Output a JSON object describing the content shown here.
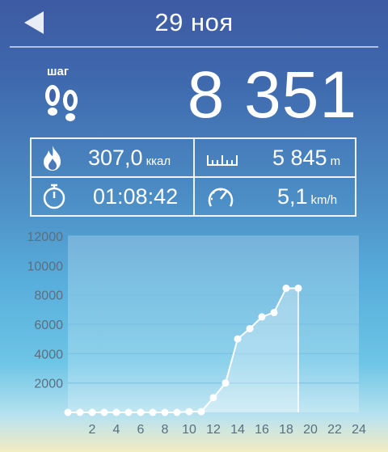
{
  "header": {
    "date": "29 ноя",
    "back_icon": "back-arrow-icon"
  },
  "steps": {
    "label": "шаг",
    "value": "8 351",
    "icon": "footprints-icon"
  },
  "stats": {
    "calories": {
      "value": "307,0",
      "unit": "ккал",
      "icon": "flame-icon"
    },
    "distance": {
      "value": "5 845",
      "unit": "m",
      "icon": "ruler-icon"
    },
    "duration": {
      "value": "01:08:42",
      "icon": "stopwatch-icon"
    },
    "speed": {
      "value": "5,1",
      "unit": "km/h",
      "icon": "speedometer-icon"
    }
  },
  "chart_data": {
    "type": "line",
    "title": "",
    "xlabel": "",
    "ylabel": "",
    "ylim": [
      0,
      12000
    ],
    "xlim": [
      0,
      24
    ],
    "yticks": [
      "2000",
      "4000",
      "6000",
      "8000",
      "10000",
      "12000"
    ],
    "ytick_values": [
      2000,
      4000,
      6000,
      8000,
      10000,
      12000
    ],
    "xticks": [
      "2",
      "4",
      "6",
      "8",
      "10",
      "12",
      "14",
      "16",
      "18",
      "20",
      "22",
      "24"
    ],
    "xtick_values": [
      2,
      4,
      6,
      8,
      10,
      12,
      14,
      16,
      18,
      20,
      22,
      24
    ],
    "x": [
      0,
      1,
      2,
      3,
      4,
      5,
      6,
      7,
      8,
      9,
      10,
      11,
      12,
      13,
      14,
      15,
      16,
      17,
      18,
      19
    ],
    "values": [
      0,
      0,
      0,
      0,
      0,
      0,
      0,
      0,
      0,
      0,
      50,
      50,
      1000,
      2000,
      5000,
      5700,
      6500,
      6800,
      8450,
      8450
    ],
    "grid": true
  }
}
